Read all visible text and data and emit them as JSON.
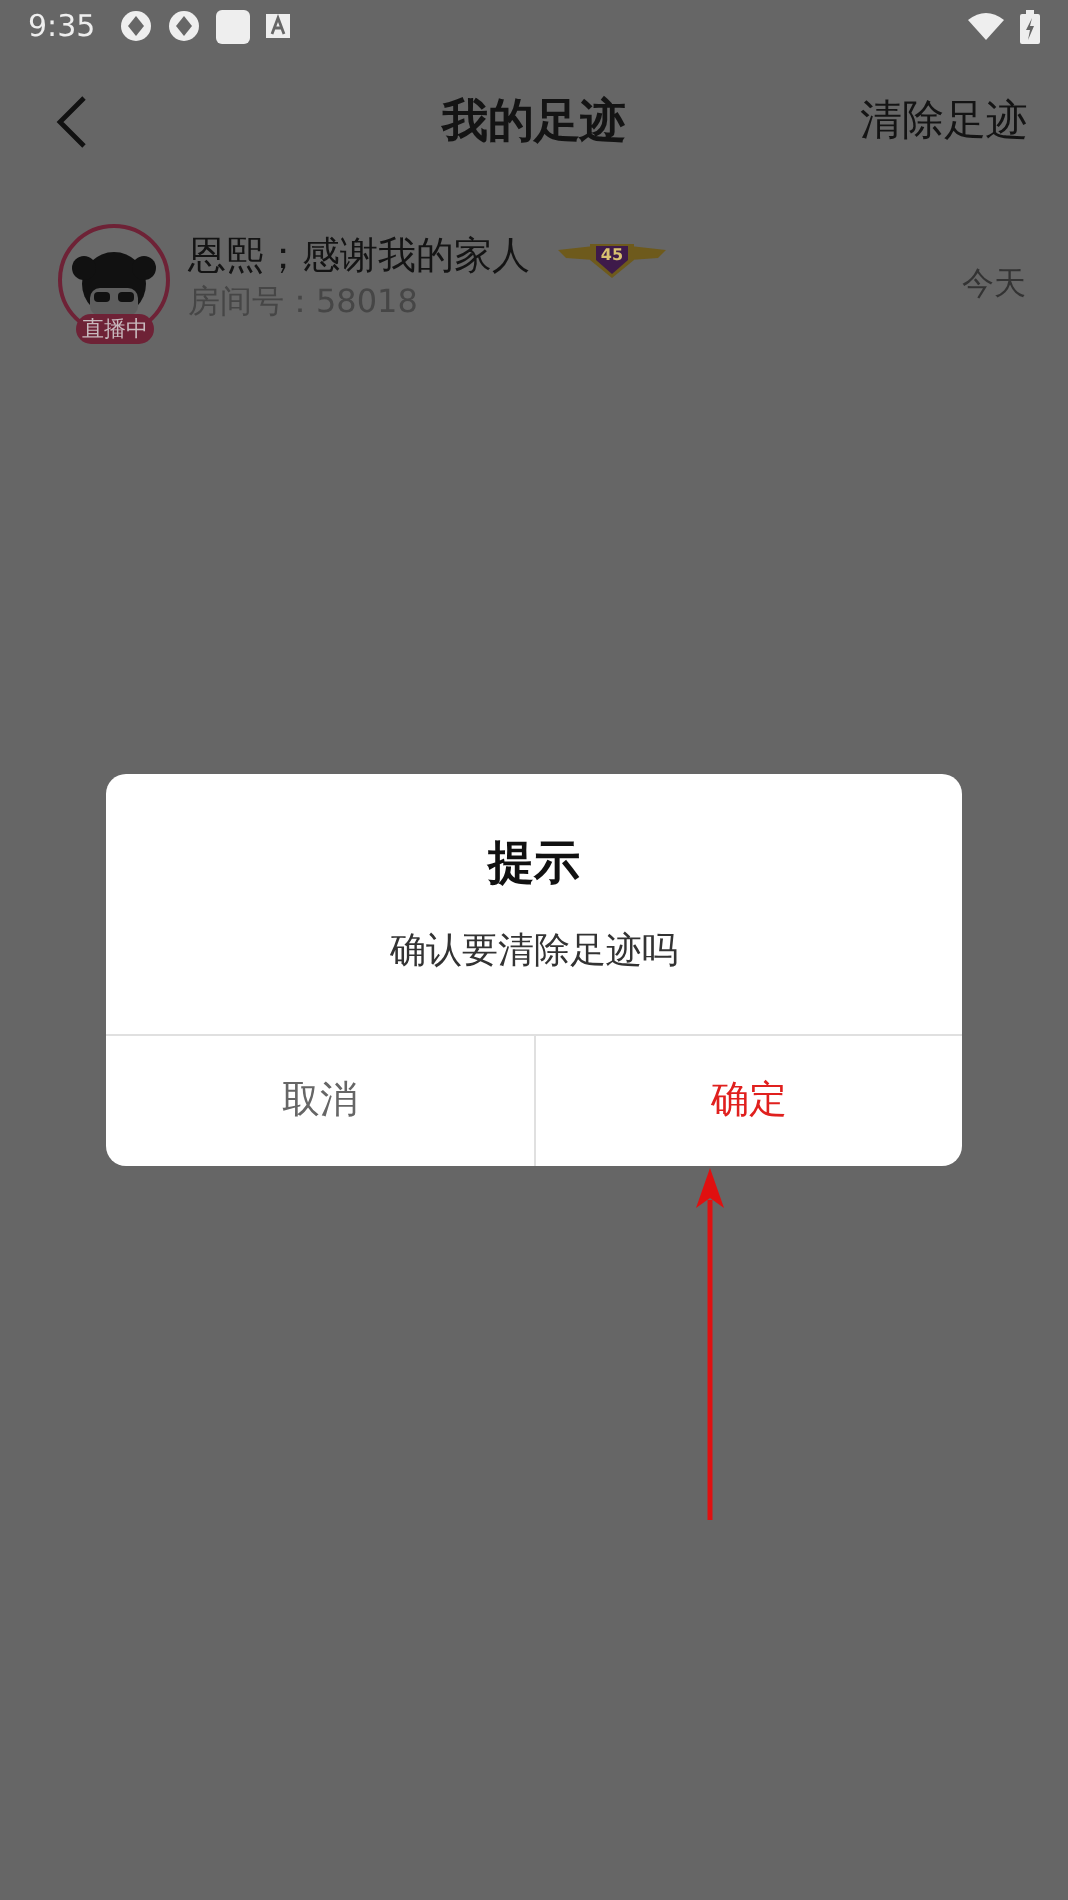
{
  "status_bar": {
    "time": "9:35"
  },
  "nav": {
    "title": "我的足迹",
    "action": "清除足迹"
  },
  "history": [
    {
      "name": "恩熙；感谢我的家人",
      "room": "房间号：58018",
      "live_badge": "直播中",
      "level_badge": "45",
      "time": "今天"
    }
  ],
  "dialog": {
    "title": "提示",
    "message": "确认要清除足迹吗",
    "buttons": [
      {
        "label": "取消",
        "kind": "cancel"
      },
      {
        "label": "确定",
        "kind": "confirm"
      }
    ]
  }
}
